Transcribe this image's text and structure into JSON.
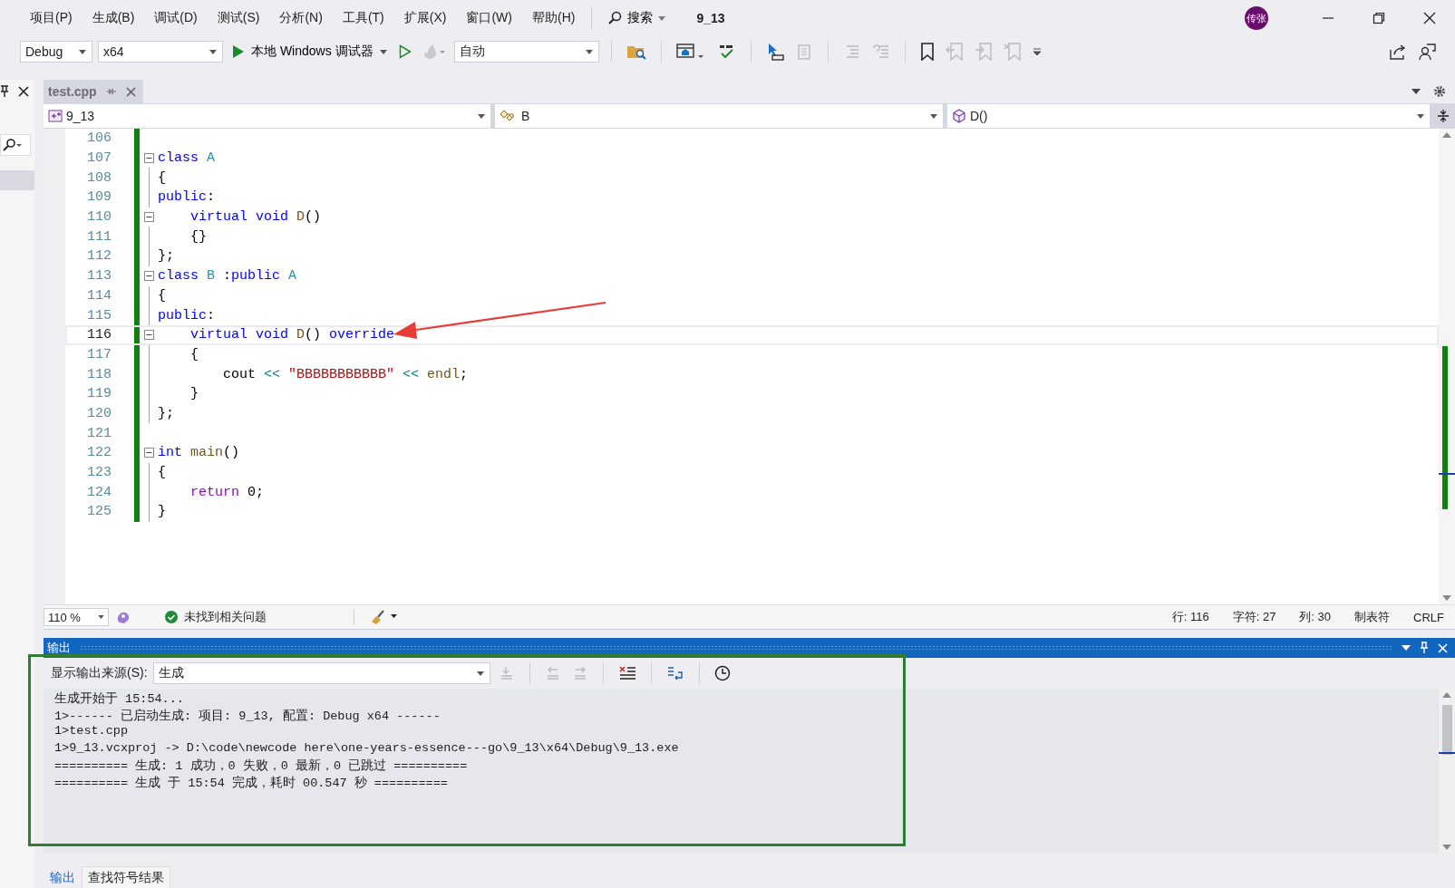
{
  "menu": [
    "项目(P)",
    "生成(B)",
    "调试(D)",
    "测试(S)",
    "分析(N)",
    "工具(T)",
    "扩展(X)",
    "窗口(W)",
    "帮助(H)"
  ],
  "search": {
    "label": "搜索"
  },
  "solution_title": "9_13",
  "avatar": {
    "label": "传张"
  },
  "toolbar": {
    "configuration": "Debug",
    "platform": "x64",
    "debugger": "本地 Windows 调试器",
    "mode": "自动"
  },
  "document_tabs": [
    {
      "label": "test.cpp",
      "selected": true
    }
  ],
  "navigation": {
    "project": "9_13",
    "scope": "B",
    "member": "D()"
  },
  "code_lines": [
    {
      "number": "106",
      "current": false,
      "changed": true,
      "collapsible": false,
      "in_block": false
    },
    {
      "number": "107",
      "current": false,
      "changed": true,
      "collapsible": true,
      "tokens": [
        {
          "t": "class ",
          "kind": "keyword"
        },
        {
          "t": "A",
          "kind": "type"
        }
      ]
    },
    {
      "number": "108",
      "current": false,
      "changed": true,
      "collapsible": false,
      "in_block": true,
      "tokens": [
        {
          "t": "{",
          "kind": "plain"
        }
      ]
    },
    {
      "number": "109",
      "current": false,
      "changed": true,
      "collapsible": false,
      "in_block": true,
      "tokens": [
        {
          "t": "public",
          "kind": "keyword"
        },
        {
          "t": ":",
          "kind": "plain"
        }
      ]
    },
    {
      "number": "110",
      "current": false,
      "changed": true,
      "collapsible": true,
      "tokens": [
        {
          "t": "    virtual void ",
          "kind": "keyword"
        },
        {
          "t": "D",
          "kind": "function"
        },
        {
          "t": "()",
          "kind": "plain"
        }
      ]
    },
    {
      "number": "111",
      "current": false,
      "changed": true,
      "collapsible": false,
      "in_block": true,
      "tokens": [
        {
          "t": "    {}",
          "kind": "plain"
        }
      ]
    },
    {
      "number": "112",
      "current": false,
      "changed": true,
      "collapsible": false,
      "in_block": true,
      "tokens": [
        {
          "t": "};",
          "kind": "plain"
        }
      ]
    },
    {
      "number": "113",
      "current": false,
      "changed": true,
      "collapsible": true,
      "tokens": [
        {
          "t": "class ",
          "kind": "keyword"
        },
        {
          "t": "B",
          "kind": "type"
        },
        {
          "t": " :",
          "kind": "plain"
        },
        {
          "t": "public ",
          "kind": "keyword"
        },
        {
          "t": "A",
          "kind": "type"
        }
      ]
    },
    {
      "number": "114",
      "current": false,
      "changed": true,
      "collapsible": false,
      "in_block": true,
      "tokens": [
        {
          "t": "{",
          "kind": "plain"
        }
      ]
    },
    {
      "number": "115",
      "current": false,
      "changed": true,
      "collapsible": false,
      "in_block": true,
      "tokens": [
        {
          "t": "public",
          "kind": "keyword"
        },
        {
          "t": ":",
          "kind": "plain"
        }
      ]
    },
    {
      "number": "116",
      "current": true,
      "changed": true,
      "collapsible": true,
      "tokens": [
        {
          "t": "    virtual void ",
          "kind": "keyword"
        },
        {
          "t": "D",
          "kind": "function"
        },
        {
          "t": "() ",
          "kind": "plain"
        },
        {
          "t": "override",
          "kind": "keyword"
        }
      ]
    },
    {
      "number": "117",
      "current": false,
      "changed": true,
      "collapsible": false,
      "in_block": true,
      "tokens": [
        {
          "t": "    {",
          "kind": "plain"
        }
      ]
    },
    {
      "number": "118",
      "current": false,
      "changed": true,
      "collapsible": false,
      "in_block": true,
      "tokens": [
        {
          "t": "        cout ",
          "kind": "plain"
        },
        {
          "t": "<< ",
          "kind": "operator"
        },
        {
          "t": "\"BBBBBBBBBBB\"",
          "kind": "string"
        },
        {
          "t": " << ",
          "kind": "operator"
        },
        {
          "t": "endl",
          "kind": "function"
        },
        {
          "t": ";",
          "kind": "plain"
        }
      ]
    },
    {
      "number": "119",
      "current": false,
      "changed": true,
      "collapsible": false,
      "in_block": true,
      "tokens": [
        {
          "t": "    }",
          "kind": "plain"
        }
      ]
    },
    {
      "number": "120",
      "current": false,
      "changed": true,
      "collapsible": false,
      "in_block": true,
      "tokens": [
        {
          "t": "};",
          "kind": "plain"
        }
      ]
    },
    {
      "number": "121",
      "current": false,
      "changed": true,
      "collapsible": false,
      "in_block": false
    },
    {
      "number": "122",
      "current": false,
      "changed": true,
      "collapsible": true,
      "tokens": [
        {
          "t": "int ",
          "kind": "keyword"
        },
        {
          "t": "main",
          "kind": "function"
        },
        {
          "t": "()",
          "kind": "plain"
        }
      ]
    },
    {
      "number": "123",
      "current": false,
      "changed": true,
      "collapsible": false,
      "in_block": true,
      "tokens": [
        {
          "t": "{",
          "kind": "plain"
        }
      ]
    },
    {
      "number": "124",
      "current": false,
      "changed": true,
      "collapsible": false,
      "in_block": true,
      "tokens": [
        {
          "t": "    return",
          "kind": "control"
        },
        {
          "t": " 0;",
          "kind": "plain"
        }
      ]
    },
    {
      "number": "125",
      "current": false,
      "changed": true,
      "collapsible": false,
      "in_block": true,
      "tokens": [
        {
          "t": "}",
          "kind": "plain"
        }
      ]
    }
  ],
  "editor_status": {
    "zoom": "110 %",
    "issues": "未找到相关问题",
    "line": "行: 116",
    "character": "字符: 27",
    "column": "列: 30",
    "indentation": "制表符",
    "line_endings": "CRLF"
  },
  "output": {
    "title": "输出",
    "source_label": "显示输出来源(S):",
    "source": "生成",
    "lines": [
      "生成开始于 15:54...",
      "1>------ 已启动生成: 项目: 9_13, 配置: Debug x64 ------",
      "1>test.cpp",
      "1>9_13.vcxproj -> D:\\code\\newcode here\\one-years-essence---go\\9_13\\x64\\Debug\\9_13.exe",
      "========== 生成: 1 成功，0 失败，0 最新，0 已跳过 ==========",
      "========== 生成 于 15:54 完成，耗时 00.547 秒 =========="
    ]
  },
  "bottom_tabs": [
    {
      "label": "输出",
      "selected": true
    },
    {
      "label": "查找符号结果",
      "selected": false
    }
  ],
  "annotations": [
    {
      "kind": "arrow",
      "color": "#e83a36"
    },
    {
      "kind": "box",
      "color": "#2e7d32"
    }
  ]
}
